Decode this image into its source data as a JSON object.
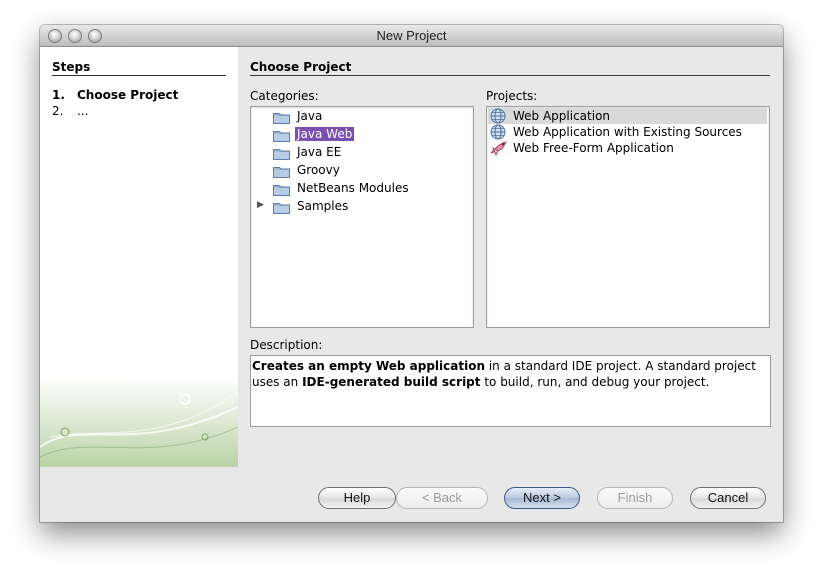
{
  "window": {
    "title": "New Project"
  },
  "steps": {
    "heading": "Steps",
    "items": [
      {
        "number": "1.",
        "label": "Choose Project"
      },
      {
        "number": "2.",
        "label": "..."
      }
    ]
  },
  "main": {
    "heading": "Choose Project",
    "categories_label": "Categories:",
    "projects_label": "Projects:",
    "description_label": "Description:"
  },
  "categories": [
    {
      "label": "Java",
      "selected": false,
      "expandable": false
    },
    {
      "label": "Java Web",
      "selected": true,
      "expandable": false
    },
    {
      "label": "Java EE",
      "selected": false,
      "expandable": false
    },
    {
      "label": "Groovy",
      "selected": false,
      "expandable": false
    },
    {
      "label": "NetBeans Modules",
      "selected": false,
      "expandable": false
    },
    {
      "label": "Samples",
      "selected": false,
      "expandable": true
    }
  ],
  "projects": [
    {
      "label": "Web Application",
      "icon": "globe-icon",
      "selected": true
    },
    {
      "label": "Web Application with Existing Sources",
      "icon": "globe-icon",
      "selected": false
    },
    {
      "label": "Web Free-Form Application",
      "icon": "freeform-project-icon",
      "selected": false
    }
  ],
  "description": {
    "part1_bold": "Creates an empty Web application",
    "part2": " in a standard IDE project. A standard project uses an ",
    "part3_bold": "IDE-generated build script",
    "part4": " to build, run, and debug your project."
  },
  "buttons": {
    "help": "Help",
    "back": "< Back",
    "next": "Next >",
    "finish": "Finish",
    "cancel": "Cancel"
  },
  "colors": {
    "selection": "#7b4fb0",
    "project_selection": "#d9d9d9",
    "window_bg": "#e8e8e8"
  }
}
